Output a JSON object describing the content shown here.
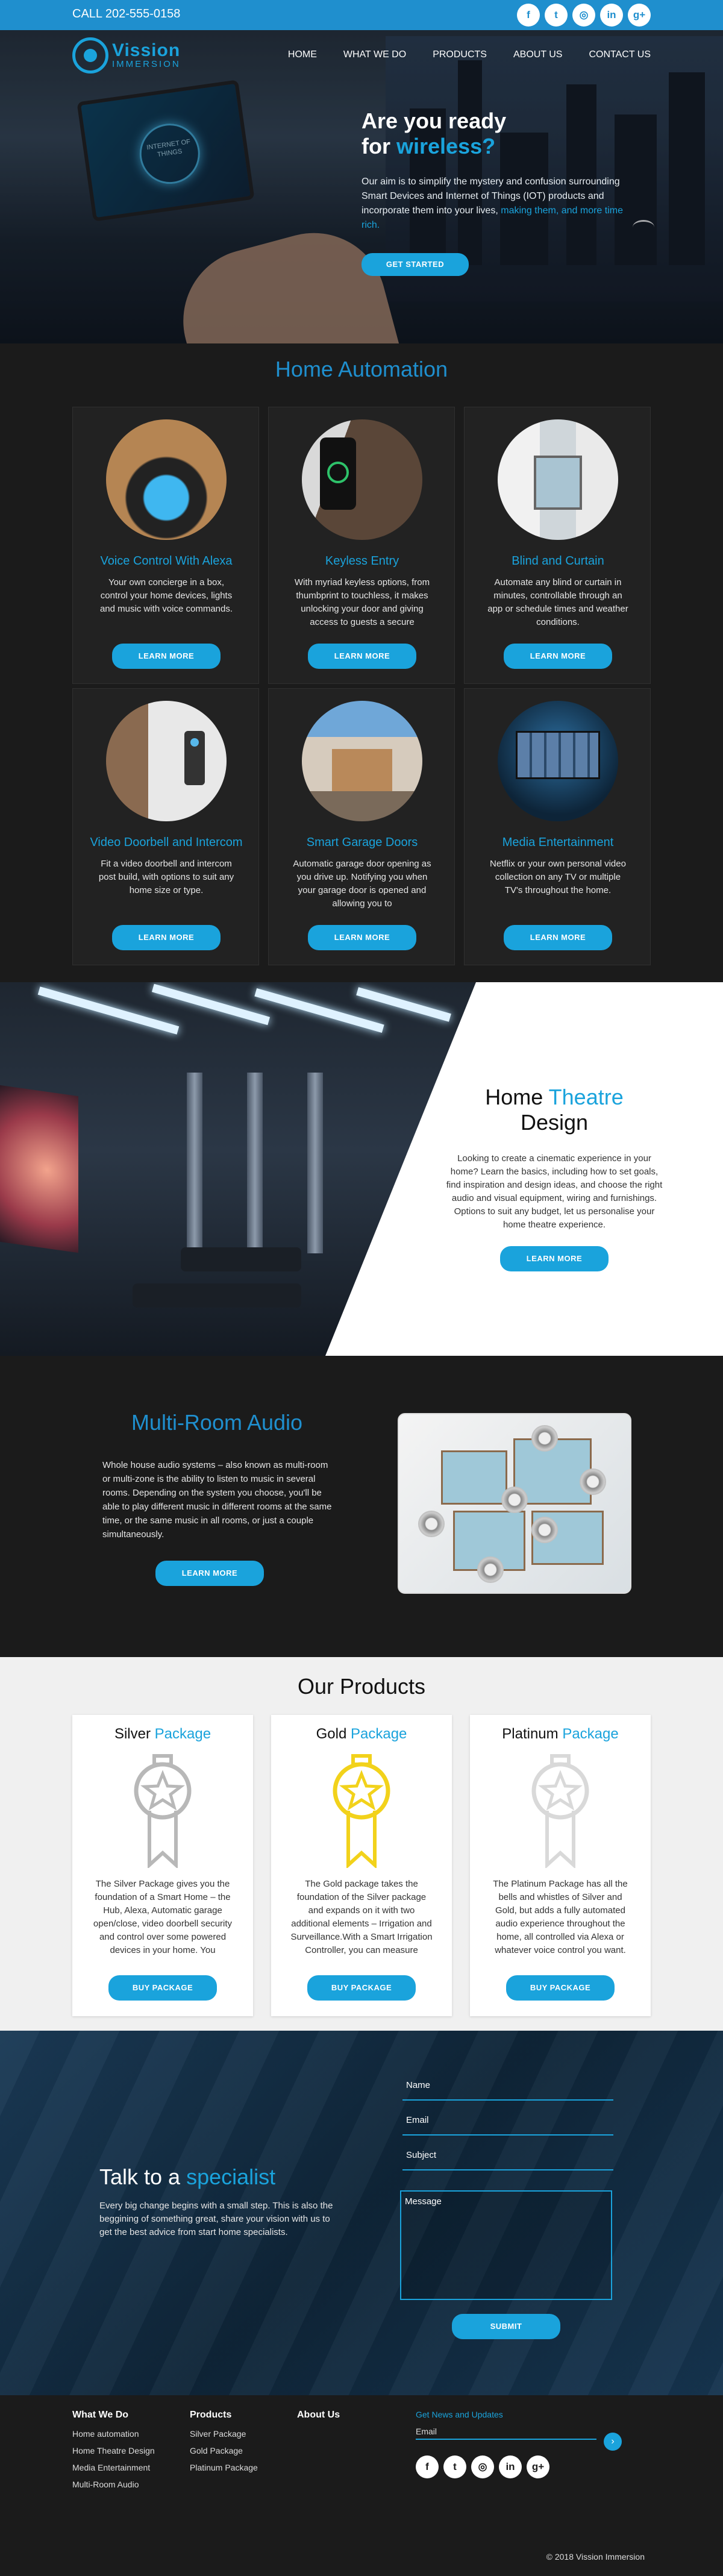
{
  "topbar": {
    "phone": "CALL 202-555-0158",
    "socials": [
      "f",
      "t",
      "◎",
      "in",
      "g+"
    ]
  },
  "brand": {
    "name": "Vission",
    "sub": "IMMERSION"
  },
  "nav": [
    "HOME",
    "WHAT WE DO",
    "PRODUCTS",
    "ABOUT US",
    "CONTACT US"
  ],
  "hero": {
    "line1": "Are you ready",
    "line2_prefix": "for",
    "line2_accent": "wireless?",
    "text": "Our aim is to simplify the mystery and confusion surrounding Smart Devices and Internet of Things (IOT) products and incorporate them into your lives,",
    "text_accent": "making them, and more time rich.",
    "button": "GET STARTED",
    "tablet_text": "INTERNET OF THINGS"
  },
  "automation": {
    "title": "Home Automation",
    "cards": [
      {
        "title": "Voice Control With Alexa",
        "text": "Your own concierge in a box, control your home devices, lights and music with voice commands.",
        "button": "LEARN MORE"
      },
      {
        "title": "Keyless Entry",
        "text": "With myriad keyless options, from thumbprint to touchless, it makes unlocking your door and giving access to guests a secure",
        "button": "LEARN MORE"
      },
      {
        "title": "Blind and Curtain",
        "text": "Automate any blind or curtain in minutes, controllable through an app or schedule times and weather conditions.",
        "button": "LEARN MORE"
      },
      {
        "title": "Video Doorbell and Intercom",
        "text": "Fit a video doorbell and intercom post build, with options to suit any home size or type.",
        "button": "LEARN MORE"
      },
      {
        "title": "Smart Garage Doors",
        "text": "Automatic garage door opening as you drive up. Notifying you when your garage door is opened and allowing you to",
        "button": "LEARN MORE"
      },
      {
        "title": "Media Entertainment",
        "text": "Netflix or your own personal video collection on any TV or multiple TV's throughout the home.",
        "button": "LEARN MORE"
      }
    ]
  },
  "theatre": {
    "title_a": "Home",
    "title_b": "Theatre",
    "title_c": "Design",
    "text": "Looking to create a cinematic experience in your home? Learn the basics, including how to set goals, find inspiration and design ideas, and choose the right audio and visual equipment, wiring and furnishings. Options to suit any budget, let us personalise your home theatre  experience.",
    "button": "LEARN MORE"
  },
  "multiroom": {
    "title": "Multi-Room Audio",
    "text": "Whole house audio systems – also known as multi-room or multi-zone is the ability to listen to music in several rooms. Depending on the system you choose, you'll be able to play different music in different rooms at the same time, or the same music in all rooms, or just a couple simultaneously.",
    "button": "LEARN MORE"
  },
  "products": {
    "title": "Our Products",
    "items": [
      {
        "name": "Silver",
        "accent": "Package",
        "color": "#b8b8b8",
        "text": "The Silver Package gives you the foundation of a Smart Home – the Hub, Alexa, Automatic garage open/close, video doorbell security and control over some powered devices in your home.  You",
        "button": "BUY PACKAGE"
      },
      {
        "name": "Gold",
        "accent": "Package",
        "color": "#f2d21b",
        "text": "The Gold package takes the foundation of the Silver package and expands on it with two additional elements – Irrigation and Surveillance.With a Smart Irrigation Controller, you can measure",
        "button": "BUY PACKAGE"
      },
      {
        "name": "Platinum",
        "accent": "Package",
        "color": "#d9d9d9",
        "text": "The Platinum Package has all the bells and whistles of Silver and Gold, but adds a fully automated audio experience throughout the home, all controlled via Alexa or whatever voice control you want.",
        "button": "BUY PACKAGE"
      }
    ]
  },
  "contact": {
    "title_a": "Talk to a",
    "title_b": "specialist",
    "text": "Every big change begins with a small step. This is also the beggining of something great, share your vision with us to get the best advice from start home specialists.",
    "fields": {
      "name": "Name",
      "email": "Email",
      "subject": "Subject",
      "message": "Message"
    },
    "button": "SUBMIT"
  },
  "footer": {
    "col1": {
      "title": "What We Do",
      "items": [
        "Home automation",
        "Home Theatre Design",
        "Media Entertainment",
        "Multi-Room Audio"
      ]
    },
    "col2": {
      "title": "Products",
      "items": [
        "Silver Package",
        "Gold Package",
        "Platinum Package"
      ]
    },
    "col3": {
      "title": "About Us"
    },
    "news_label": "Get News and Updates",
    "email_placeholder": "Email",
    "copyright": "© 2018 Vission Immersion"
  }
}
